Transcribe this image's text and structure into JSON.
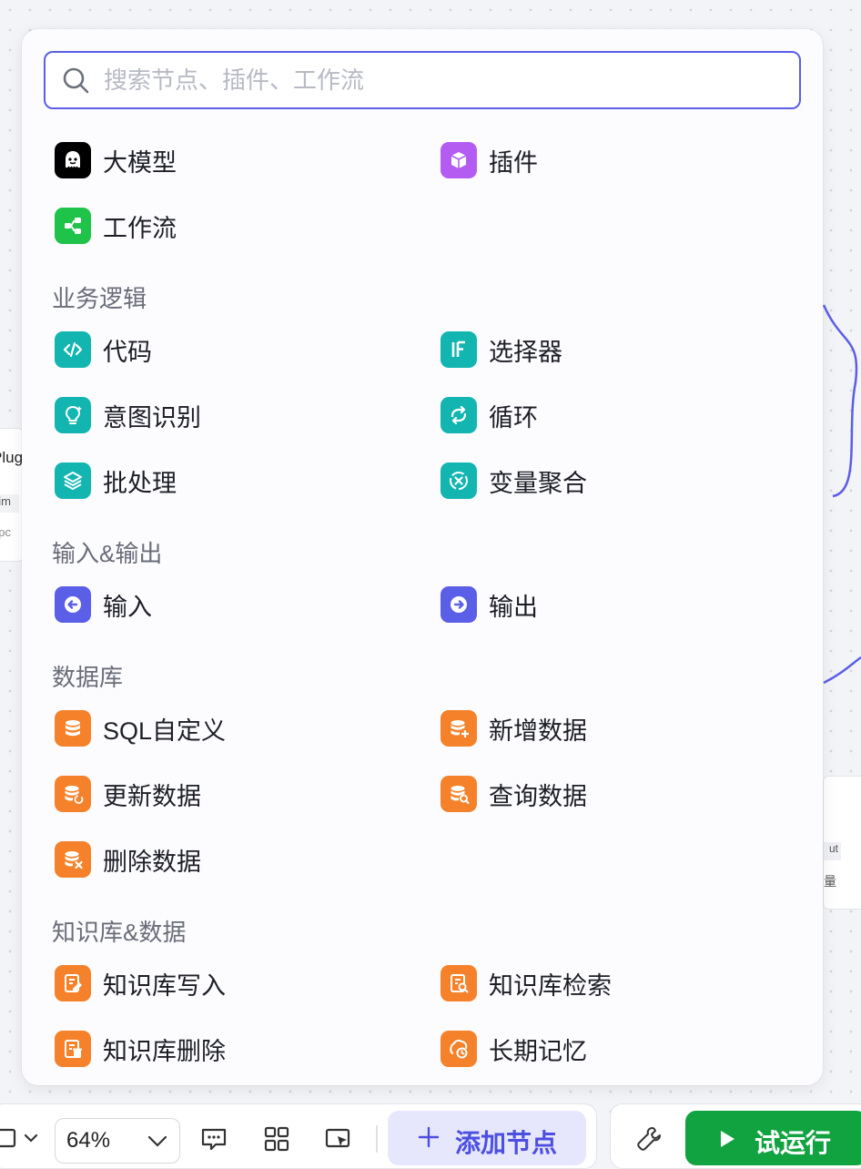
{
  "search": {
    "placeholder": "搜索节点、插件、工作流"
  },
  "top_items": [
    {
      "label": "大模型",
      "icon": "llm-icon",
      "color": "#000000"
    },
    {
      "label": "插件",
      "icon": "plugin-cube-icon",
      "color": "#b45cf2"
    },
    {
      "label": "工作流",
      "icon": "workflow-icon",
      "color": "#1fc34a"
    }
  ],
  "sections": [
    {
      "title": "业务逻辑",
      "items": [
        {
          "label": "代码",
          "icon": "code-icon",
          "color": "#13b5b1"
        },
        {
          "label": "选择器",
          "icon": "if-icon",
          "color": "#13b5b1"
        },
        {
          "label": "意图识别",
          "icon": "bulb-icon",
          "color": "#13b5b1"
        },
        {
          "label": "循环",
          "icon": "loop-icon",
          "color": "#13b5b1"
        },
        {
          "label": "批处理",
          "icon": "layers-icon",
          "color": "#13b5b1"
        },
        {
          "label": "变量聚合",
          "icon": "variable-icon",
          "color": "#13b5b1"
        }
      ]
    },
    {
      "title": "输入&输出",
      "items": [
        {
          "label": "输入",
          "icon": "input-arrow-icon",
          "color": "#5b5ee6"
        },
        {
          "label": "输出",
          "icon": "output-arrow-icon",
          "color": "#5b5ee6"
        }
      ]
    },
    {
      "title": "数据库",
      "items": [
        {
          "label": "SQL自定义",
          "icon": "database-icon",
          "color": "#f5822a"
        },
        {
          "label": "新增数据",
          "icon": "database-add-icon",
          "color": "#f5822a"
        },
        {
          "label": "更新数据",
          "icon": "database-refresh-icon",
          "color": "#f5822a"
        },
        {
          "label": "查询数据",
          "icon": "database-search-icon",
          "color": "#f5822a"
        },
        {
          "label": "删除数据",
          "icon": "database-delete-icon",
          "color": "#f5822a"
        }
      ]
    },
    {
      "title": "知识库&数据",
      "items": [
        {
          "label": "知识库写入",
          "icon": "kb-write-icon",
          "color": "#f5822a"
        },
        {
          "label": "知识库检索",
          "icon": "kb-search-icon",
          "color": "#f5822a"
        },
        {
          "label": "知识库删除",
          "icon": "kb-delete-icon",
          "color": "#f5822a"
        },
        {
          "label": "长期记忆",
          "icon": "memory-icon",
          "color": "#f5822a"
        }
      ]
    }
  ],
  "toolbar": {
    "zoom_value": "64%",
    "add_node_label": "添加节点",
    "run_label": "试运行"
  },
  "canvas": {
    "left_node_title": "Plug",
    "left_node_param": "_im",
    "left_node_sub": "r.pc",
    "right_node_tag": "ut",
    "right_node_sub": "量"
  },
  "colors": {
    "accent": "#5b5ee6",
    "run": "#11a33f",
    "teal": "#13b5b1",
    "orange": "#f5822a"
  }
}
